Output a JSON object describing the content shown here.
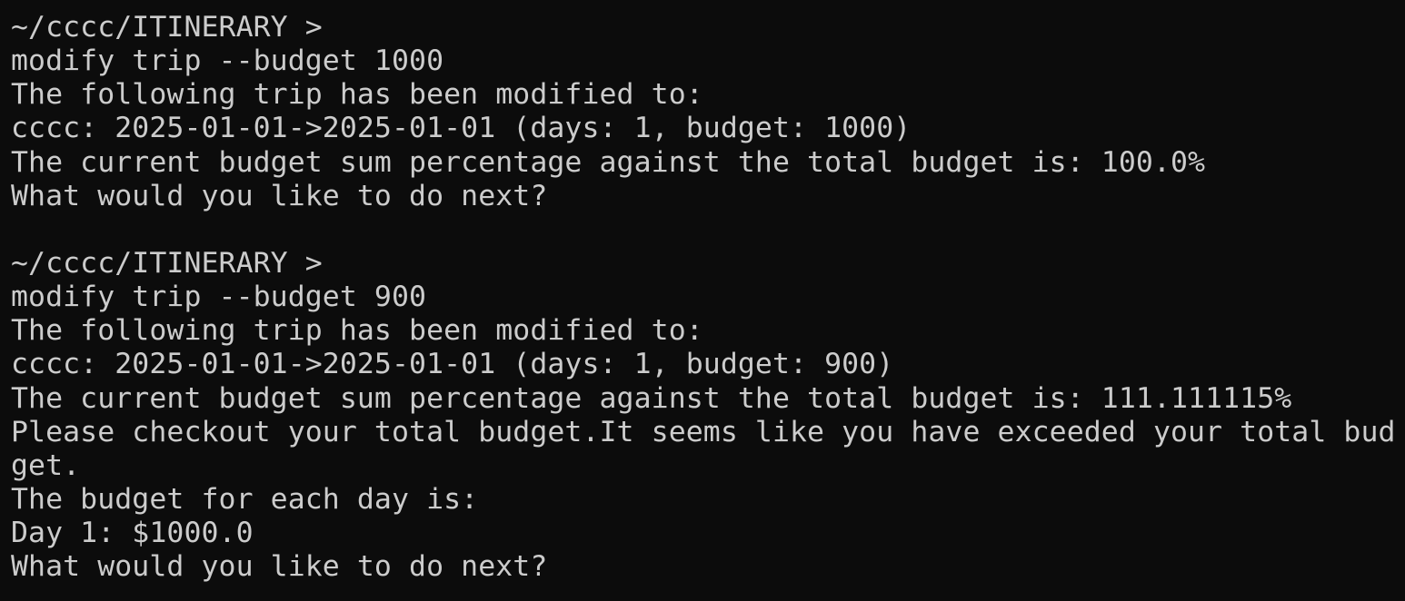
{
  "terminal": {
    "lines": [
      "~/cccc/ITINERARY >",
      "modify trip --budget 1000",
      "The following trip has been modified to:",
      "cccc: 2025-01-01->2025-01-01 (days: 1, budget: 1000)",
      "The current budget sum percentage against the total budget is: 100.0%",
      "What would you like to do next?",
      "",
      "~/cccc/ITINERARY >",
      "modify trip --budget 900",
      "The following trip has been modified to:",
      "cccc: 2025-01-01->2025-01-01 (days: 1, budget: 900)",
      "The current budget sum percentage against the total budget is: 111.111115%",
      "Please checkout your total budget.It seems like you have exceeded your total bud",
      "get.",
      "The budget for each day is:",
      "Day 1: $1000.0",
      "What would you like to do next?"
    ]
  },
  "colors": {
    "background": "#0c0c0c",
    "foreground": "#cccccc"
  }
}
